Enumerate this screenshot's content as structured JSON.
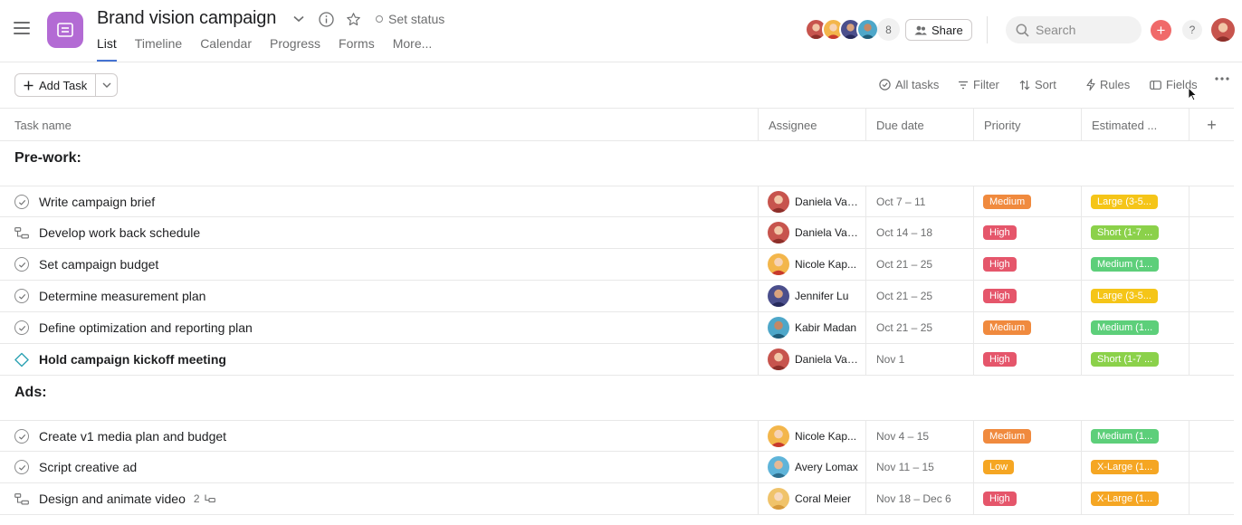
{
  "header": {
    "title": "Brand vision campaign",
    "set_status": "Set status",
    "tabs": [
      {
        "label": "List",
        "active": true
      },
      {
        "label": "Timeline"
      },
      {
        "label": "Calendar"
      },
      {
        "label": "Progress"
      },
      {
        "label": "Forms"
      },
      {
        "label": "More..."
      }
    ],
    "member_count": "8",
    "share_label": "Share",
    "search_placeholder": "Search",
    "plus_label": "+",
    "help_label": "?"
  },
  "toolbar": {
    "add_task": "Add Task",
    "all_tasks": "All tasks",
    "filter": "Filter",
    "sort": "Sort",
    "rules": "Rules",
    "fields": "Fields"
  },
  "columns": {
    "task_name": "Task name",
    "assignee": "Assignee",
    "due_date": "Due date",
    "priority": "Priority",
    "estimated": "Estimated ..."
  },
  "colors": {
    "accent": "#4573d2",
    "project_icon": "#b36bd4",
    "medium": "#f08a3e",
    "high": "#e5566b",
    "low": "#f5a623",
    "large": "#f5c518",
    "short": "#8bd14a",
    "medium_est": "#5dcf7a",
    "xlarge": "#f5a623"
  },
  "sections": [
    {
      "title": "Pre-work:",
      "tasks": [
        {
          "icon": "check",
          "name": "Write campaign brief",
          "assignee": "Daniela Var...",
          "due": "Oct 7 – 11",
          "priority": "Medium",
          "estimate": "Large (3-5..."
        },
        {
          "icon": "subtask",
          "name": "Develop work back schedule",
          "assignee": "Daniela Var...",
          "due": "Oct 14 – 18",
          "priority": "High",
          "estimate": "Short (1-7 ..."
        },
        {
          "icon": "check",
          "name": "Set campaign budget",
          "assignee": "Nicole Kap...",
          "due": "Oct 21 – 25",
          "priority": "High",
          "estimate": "Medium (1..."
        },
        {
          "icon": "check",
          "name": "Determine measurement plan",
          "assignee": "Jennifer Lu",
          "due": "Oct 21 – 25",
          "priority": "High",
          "estimate": "Large (3-5..."
        },
        {
          "icon": "check",
          "name": "Define optimization and reporting plan",
          "assignee": "Kabir Madan",
          "due": "Oct 21 – 25",
          "priority": "Medium",
          "estimate": "Medium (1..."
        },
        {
          "icon": "milestone",
          "name": "Hold campaign kickoff meeting",
          "assignee": "Daniela Var...",
          "due": "Nov 1",
          "priority": "High",
          "estimate": "Short (1-7 ..."
        }
      ]
    },
    {
      "title": "Ads:",
      "tasks": [
        {
          "icon": "check",
          "name": "Create v1 media plan and budget",
          "assignee": "Nicole Kap...",
          "due": "Nov 4 – 15",
          "priority": "Medium",
          "estimate": "Medium (1..."
        },
        {
          "icon": "check",
          "name": "Script creative ad",
          "assignee": "Avery Lomax",
          "due": "Nov 11 – 15",
          "priority": "Low",
          "estimate": "X-Large (1..."
        },
        {
          "icon": "subtask",
          "name": "Design and animate video",
          "subtasks": "2",
          "assignee": "Coral Meier",
          "due": "Nov 18 – Dec 6",
          "priority": "High",
          "estimate": "X-Large (1..."
        }
      ]
    }
  ]
}
